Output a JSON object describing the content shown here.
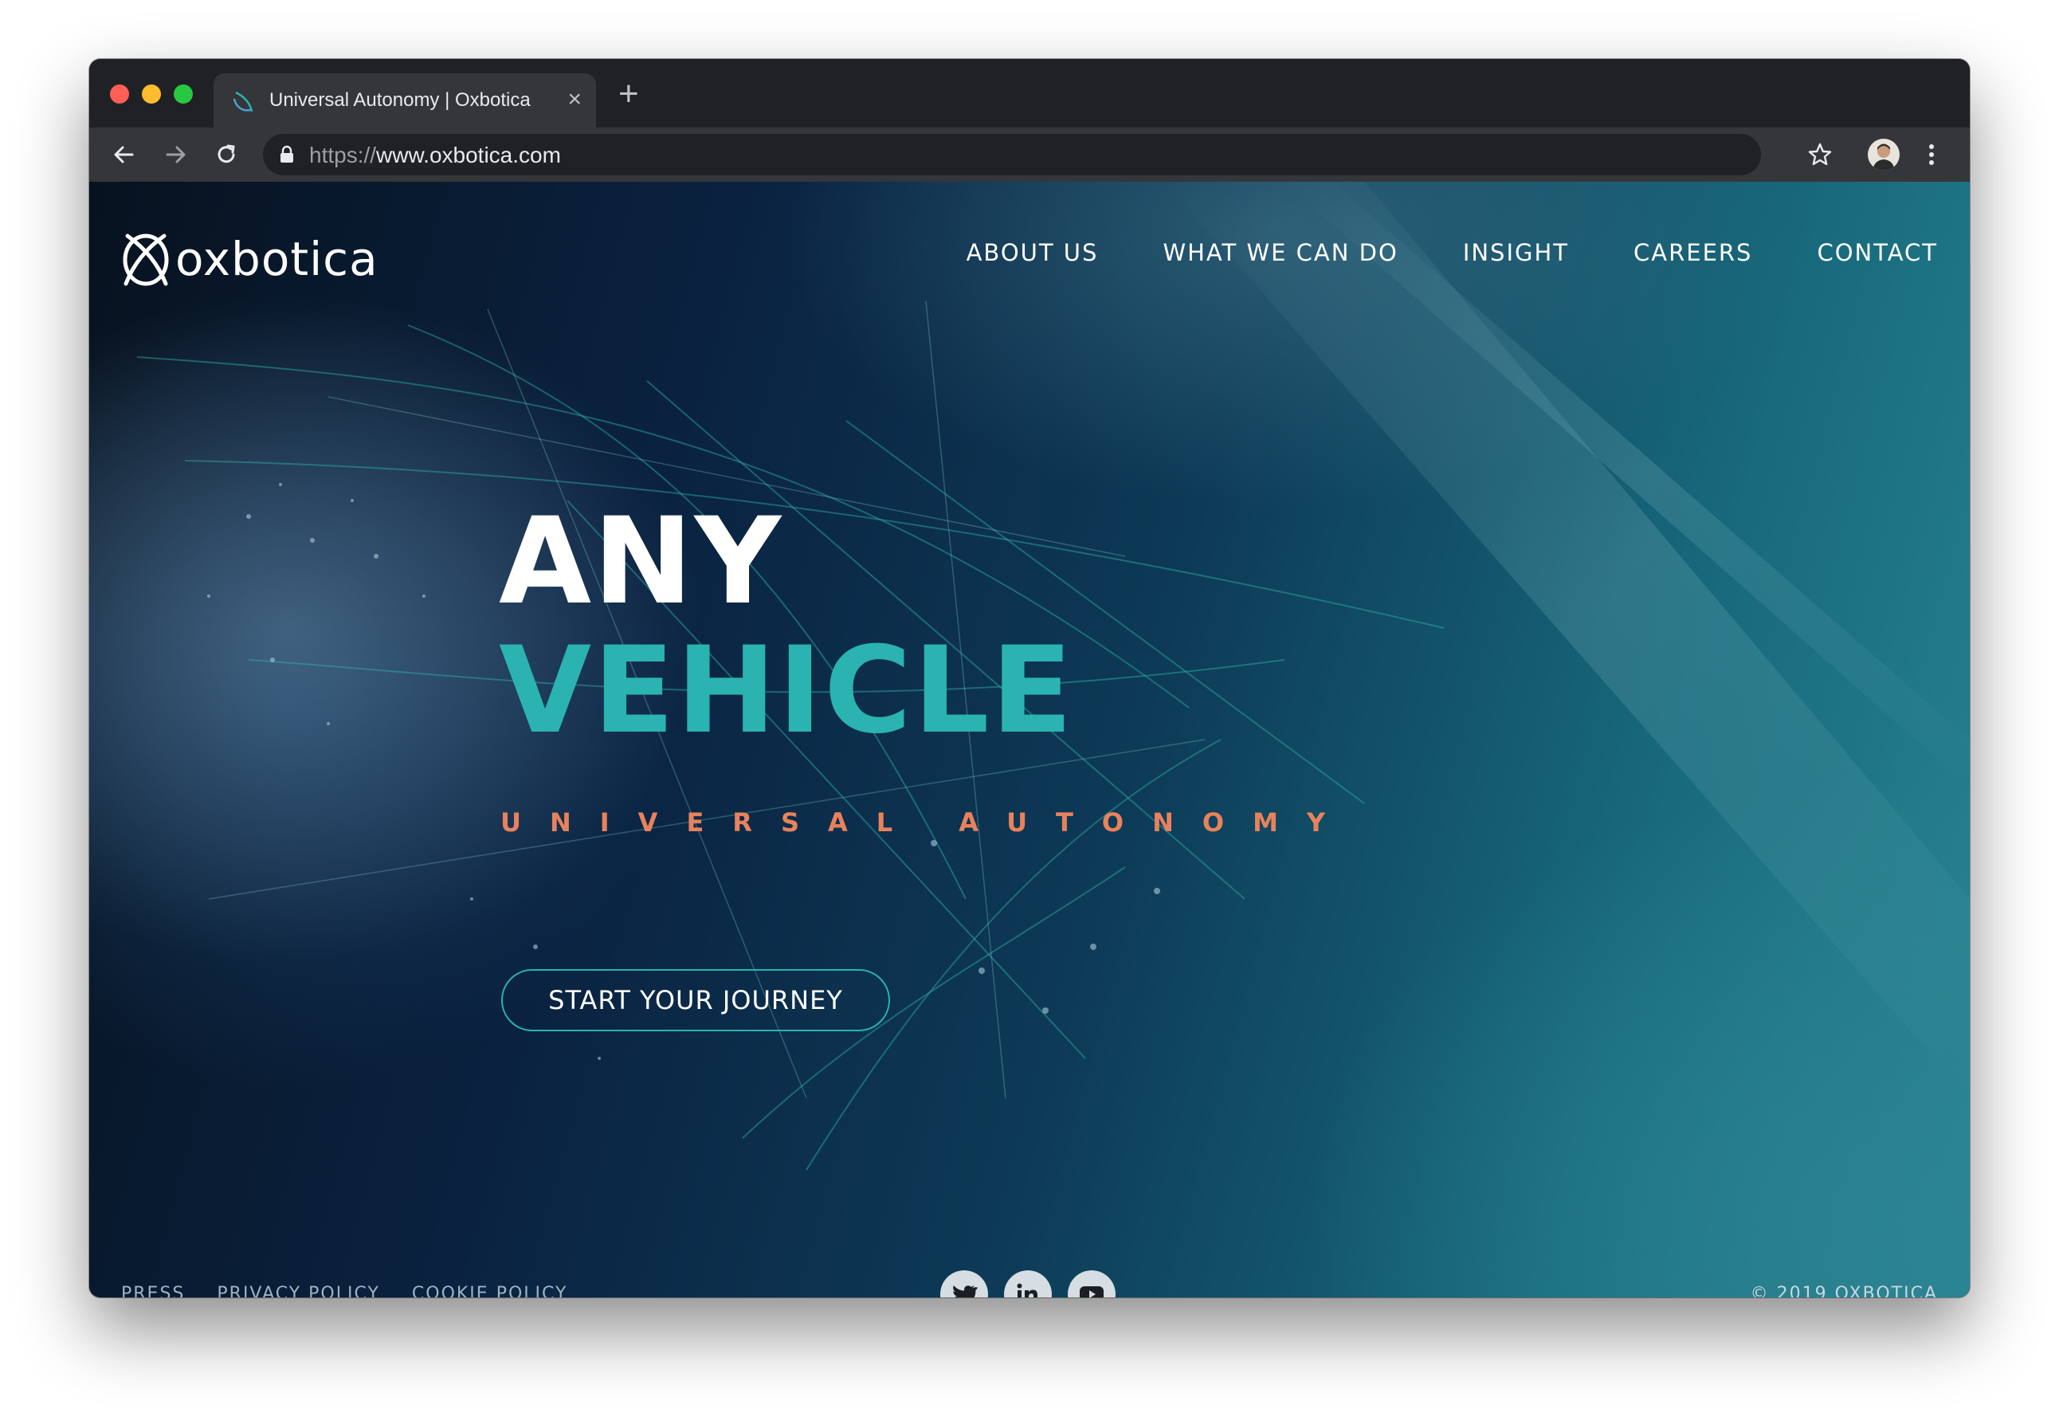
{
  "browser": {
    "tab": {
      "title": "Universal Autonomy | Oxbotica",
      "favicon": "oxbotica-favicon-icon"
    },
    "url": {
      "scheme": "https://",
      "host": "www.oxbotica.com"
    },
    "colors": {
      "tabstrip": "#202124",
      "toolbar": "#35363a"
    }
  },
  "site": {
    "logo": {
      "text": "oxbotica"
    },
    "nav": [
      {
        "label": "ABOUT US"
      },
      {
        "label": "WHAT WE CAN DO"
      },
      {
        "label": "INSIGHT"
      },
      {
        "label": "CAREERS"
      },
      {
        "label": "CONTACT"
      }
    ],
    "hero": {
      "line1": "ANY",
      "line2": "VEHICLE",
      "tagline": "UNIVERSAL AUTONOMY",
      "cta": "START YOUR JOURNEY"
    },
    "footer": {
      "links": [
        {
          "label": "PRESS"
        },
        {
          "label": "PRIVACY POLICY"
        },
        {
          "label": "COOKIE POLICY"
        }
      ],
      "socials": [
        {
          "icon": "twitter-icon"
        },
        {
          "icon": "linkedin-icon"
        },
        {
          "icon": "youtube-icon"
        }
      ],
      "copyright": "© 2019 OXBOTICA"
    },
    "colors": {
      "accent_teal": "#2ab3b1",
      "accent_orange": "#e8825c",
      "text_white": "#ffffff"
    }
  }
}
